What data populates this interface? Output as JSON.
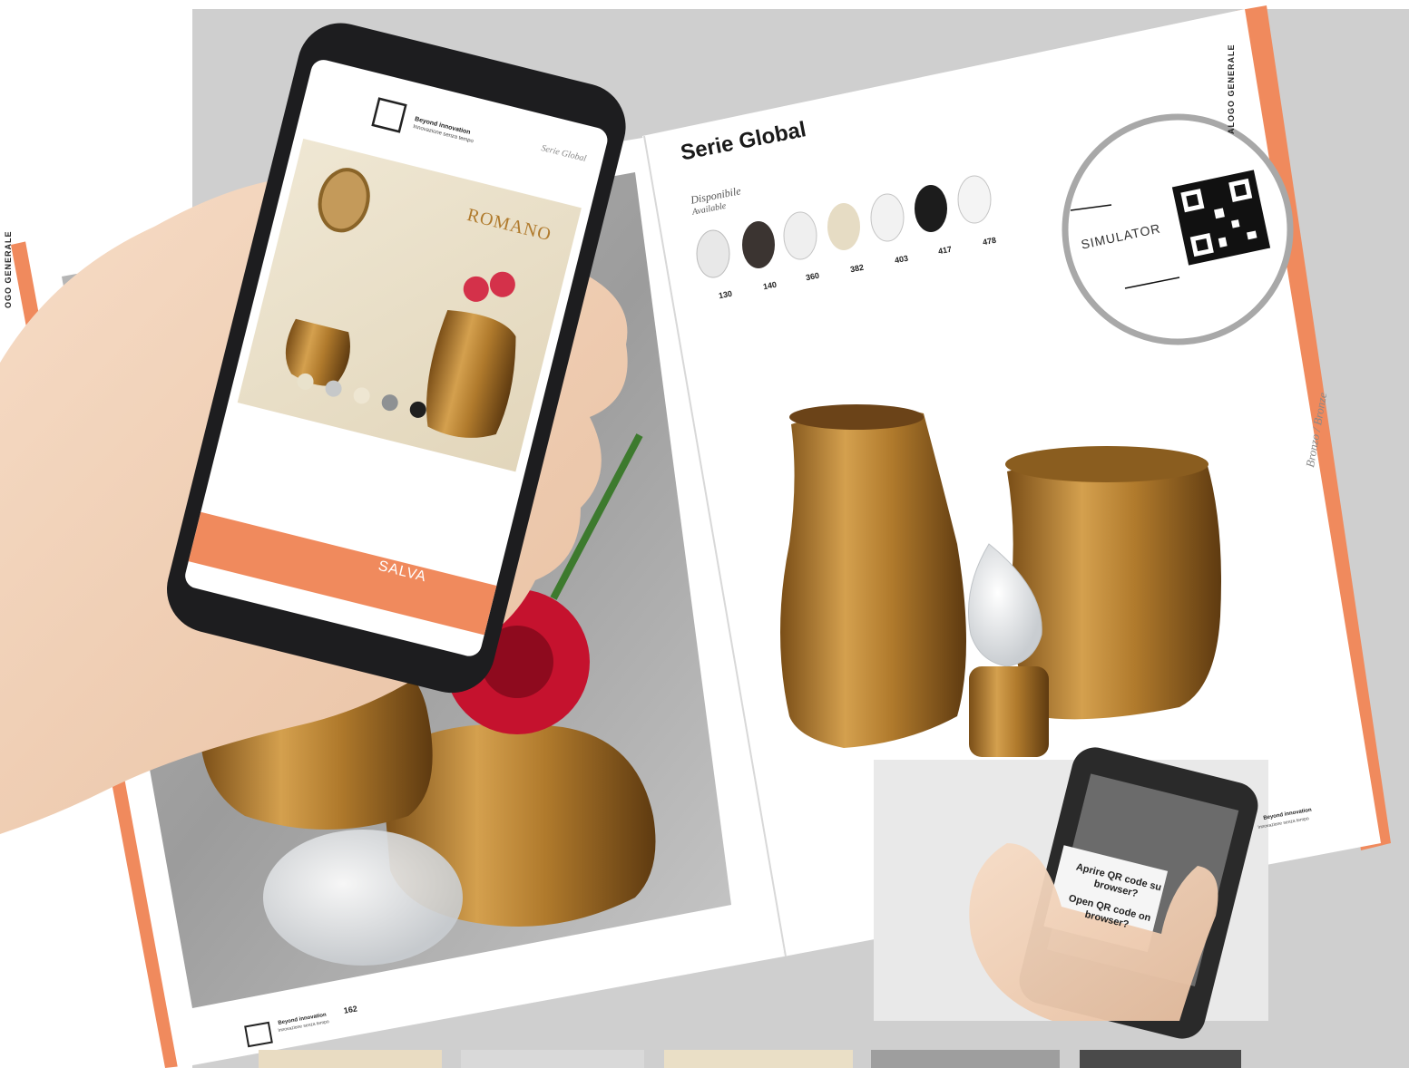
{
  "catalog": {
    "spine_label_left": "OGO GENERALE",
    "spine_label_right": "ALOGO GENERALE",
    "brand_name": "Beyond innovation",
    "brand_tagline": "Innovazione senza tempo",
    "page_number_left": "162"
  },
  "right_page": {
    "series_title": "Serie Global",
    "available_it": "Disponibile",
    "available_en": "Available",
    "finish_codes": [
      "130",
      "140",
      "360",
      "382",
      "403",
      "417",
      "478"
    ],
    "simulator_label": "SIMULATOR",
    "side_label": "Bronzo / Bronze"
  },
  "phone_app": {
    "brand_name": "Beyond innovation",
    "brand_tagline": "Innovazione senza tempo",
    "series_label": "Serie Global",
    "product_name": "ROMANO",
    "save_button_label": "SALVA",
    "swatch_colors": [
      "#e9e2cc",
      "#c6c8c9",
      "#eee6d2",
      "#8e9193",
      "#1f1f1f"
    ]
  },
  "scan_inset": {
    "prompt_it": "Aprire QR code su browser?",
    "prompt_en": "Open QR code on browser?"
  },
  "colors": {
    "accent_orange": "#f08a5d",
    "bronze": "#b07a2c"
  }
}
